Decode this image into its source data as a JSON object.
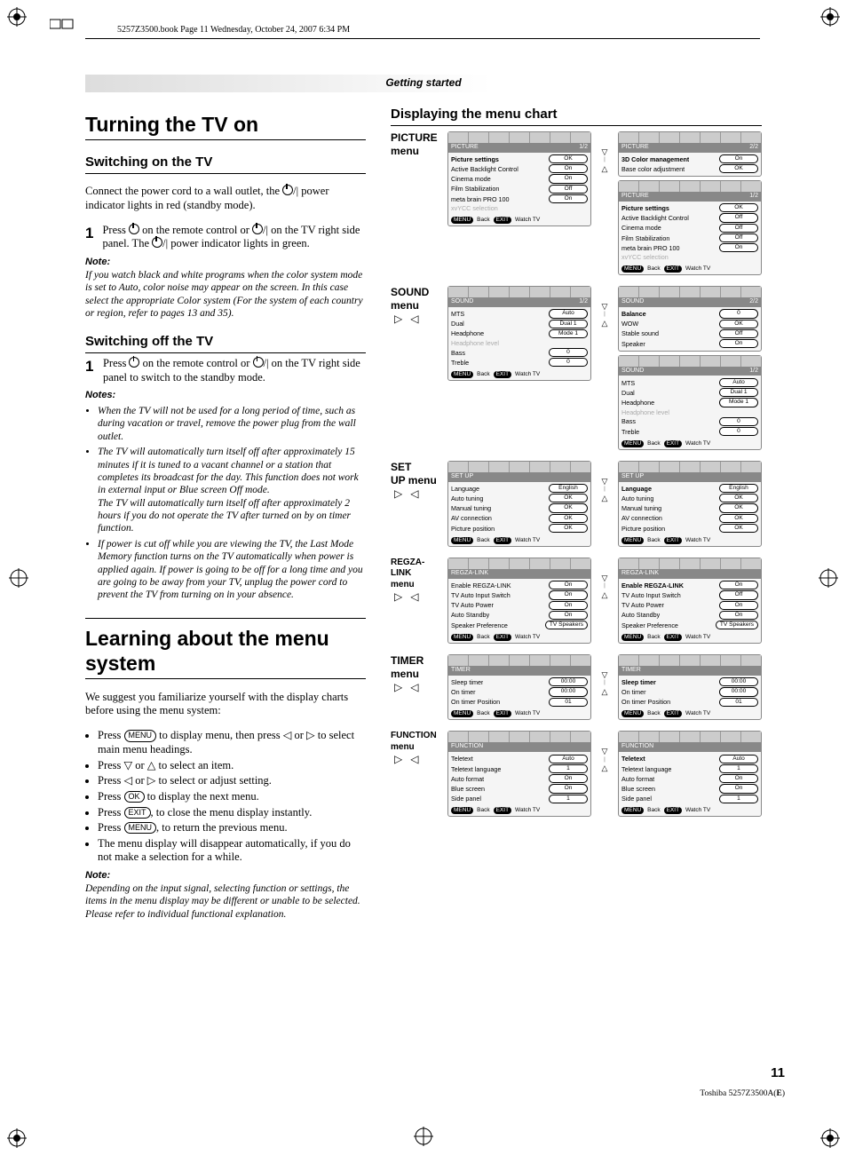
{
  "book_header": "5257Z3500.book  Page 11  Wednesday, October 24, 2007  6:34 PM",
  "section_bar": "Getting started",
  "page_number": "11",
  "footer_code": "Toshiba 5257Z3500A(E)",
  "left": {
    "h1a": "Turning the TV on",
    "switch_on_h": "Switching on the TV",
    "switch_on_p": "Connect the power cord to a wall outlet, the ␣ power indicator lights in red (standby mode).",
    "step1on": "Press ␣ on the remote control or ␣/| on the TV right side panel. The ␣/| power indicator lights in green.",
    "note_hd": "Note:",
    "note_on": "If you watch black and white programs when the color system mode is set to Auto, color noise may appear on the screen. In this case select the appropriate Color system (For the system of each country or region, refer to pages 13 and 35).",
    "switch_off_h": "Switching off the TV",
    "step1off": "Press ␣ on the remote control or ␣/| on the TV right side panel to switch to the standby mode.",
    "notes_hd": "Notes:",
    "note_off_1": "When the TV will not be used for a long period of time, such as during vacation or travel, remove the power plug from the wall outlet.",
    "note_off_2": "The TV will automatically turn itself off after approximately 15 minutes if it is tuned to a vacant channel or a station that completes its broadcast for the day. This function does not work in external input or Blue screen Off mode.\nThe TV will automatically turn itself off after approximately 2 hours if you do not operate the TV after turned on by on timer function.",
    "note_off_3": "If power is cut off while you are viewing the TV, the Last Mode Memory function turns on the TV automatically when power is applied again. If power is going to be off for a long time and you are going to be away from your TV, unplug the power cord to prevent the TV from turning on in your absence.",
    "h1b": "Learning about the menu system",
    "learn_intro": "We suggest you familiarize yourself with the display charts before using the menu system:",
    "learn_b1_a": "Press ",
    "learn_b1_b": " to display menu, then press ◁ or ▷ to select main menu headings.",
    "learn_b2": "Press ▽ or △ to select an item.",
    "learn_b3": "Press ◁ or ▷ to select or adjust setting.",
    "learn_b4_a": "Press ",
    "learn_b4_b": " to display the next menu.",
    "learn_b5_a": "Press ",
    "learn_b5_b": ", to close the menu display instantly.",
    "learn_b6_a": "Press ",
    "learn_b6_b": ", to return the previous menu.",
    "learn_b7": "The menu display will disappear automatically, if you do not make a selection for a while.",
    "learn_note": "Depending on the input signal, selecting function or settings, the items in the menu display may be different or unable to be selected. Please refer to individual functional explanation.",
    "pill_menu": "MENU",
    "pill_ok": "OK",
    "pill_exit": "EXIT"
  },
  "right": {
    "h2": "Displaying the menu chart",
    "foot_menu": "MENU",
    "foot_back": "Back",
    "foot_exit": "EXIT",
    "foot_watch": "Watch TV",
    "labels": {
      "picture": "PICTURE menu",
      "sound": "SOUND menu",
      "setup": "SET UP menu",
      "regza": "REGZA-LINK menu",
      "timer": "TIMER menu",
      "function": "FUNCTION menu"
    },
    "picture_l": {
      "title": "PICTURE",
      "page": "1/2",
      "items": [
        {
          "lab": "Picture settings",
          "val": "OK",
          "sel": true
        },
        {
          "lab": "Active Backlight Control",
          "val": "On"
        },
        {
          "lab": "Cinema mode",
          "val": "On"
        },
        {
          "lab": "Film Stabilization",
          "val": "Off"
        },
        {
          "lab": "meta brain PRO 100",
          "val": "On"
        },
        {
          "lab": "xvYCC selection",
          "val": "",
          "disabled": true
        }
      ]
    },
    "picture_r_top": {
      "title": "PICTURE",
      "page": "2/2",
      "items": [
        {
          "lab": "3D Color management",
          "val": "On",
          "sel": true
        },
        {
          "lab": "Base color adjustment",
          "val": "OK"
        }
      ]
    },
    "picture_r_bot": {
      "title": "PICTURE",
      "page": "1/2",
      "items": [
        {
          "lab": "Picture settings",
          "val": "OK",
          "sel": true
        },
        {
          "lab": "Active Backlight Control",
          "val": "Off"
        },
        {
          "lab": "Cinema mode",
          "val": "Off"
        },
        {
          "lab": "Film Stabilization",
          "val": "Off"
        },
        {
          "lab": "meta brain PRO 100",
          "val": "On"
        },
        {
          "lab": "xvYCC selection",
          "val": "",
          "disabled": true
        }
      ]
    },
    "sound_l": {
      "title": "SOUND",
      "page": "1/2",
      "items": [
        {
          "lab": "MTS",
          "val": "Auto"
        },
        {
          "lab": "Dual",
          "val": "Dual 1"
        },
        {
          "lab": "Headphone",
          "val": "Mode 1"
        },
        {
          "lab": "Headphone level",
          "val": "",
          "disabled": true
        },
        {
          "lab": "Bass",
          "val": "0"
        },
        {
          "lab": "Treble",
          "val": "0"
        }
      ]
    },
    "sound_r_top": {
      "title": "SOUND",
      "page": "2/2",
      "items": [
        {
          "lab": "Balance",
          "val": "0",
          "sel": true
        },
        {
          "lab": "WOW",
          "val": "OK"
        },
        {
          "lab": "Stable sound",
          "val": "Off"
        },
        {
          "lab": "Speaker",
          "val": "On"
        }
      ]
    },
    "sound_r_bot": {
      "title": "SOUND",
      "page": "1/2",
      "items": [
        {
          "lab": "MTS",
          "val": "Auto"
        },
        {
          "lab": "Dual",
          "val": "Dual 1"
        },
        {
          "lab": "Headphone",
          "val": "Mode 1"
        },
        {
          "lab": "Headphone level",
          "val": "",
          "disabled": true
        },
        {
          "lab": "Bass",
          "val": "0"
        },
        {
          "lab": "Treble",
          "val": "0"
        }
      ]
    },
    "setup_l": {
      "title": "SET UP",
      "page": "",
      "items": [
        {
          "lab": "Language",
          "val": "English"
        },
        {
          "lab": "Auto tuning",
          "val": "OK"
        },
        {
          "lab": "Manual tuning",
          "val": "OK"
        },
        {
          "lab": "AV connection",
          "val": "OK"
        },
        {
          "lab": "Picture position",
          "val": "OK"
        }
      ]
    },
    "setup_r": {
      "title": "SET UP",
      "page": "",
      "items": [
        {
          "lab": "Language",
          "val": "English",
          "sel": true
        },
        {
          "lab": "Auto tuning",
          "val": "OK"
        },
        {
          "lab": "Manual tuning",
          "val": "OK"
        },
        {
          "lab": "AV connection",
          "val": "OK"
        },
        {
          "lab": "Picture position",
          "val": "OK"
        }
      ]
    },
    "regza_l": {
      "title": "REGZA-LINK",
      "page": "",
      "items": [
        {
          "lab": "Enable REGZA-LINK",
          "val": "On"
        },
        {
          "lab": "TV Auto Input Switch",
          "val": "On"
        },
        {
          "lab": "TV Auto Power",
          "val": "On"
        },
        {
          "lab": "Auto Standby",
          "val": "On"
        },
        {
          "lab": "Speaker Preference",
          "val": "TV Speakers"
        }
      ]
    },
    "regza_r": {
      "title": "REGZA-LINK",
      "page": "",
      "items": [
        {
          "lab": "Enable REGZA-LINK",
          "val": "On",
          "sel": true
        },
        {
          "lab": "TV Auto Input Switch",
          "val": "Off"
        },
        {
          "lab": "TV Auto Power",
          "val": "On"
        },
        {
          "lab": "Auto Standby",
          "val": "On"
        },
        {
          "lab": "Speaker Preference",
          "val": "TV Speakers"
        }
      ]
    },
    "timer_l": {
      "title": "TIMER",
      "page": "",
      "items": [
        {
          "lab": "Sleep timer",
          "val": "00:00"
        },
        {
          "lab": "On timer",
          "val": "00:00"
        },
        {
          "lab": "On timer Position",
          "val": "01"
        }
      ]
    },
    "timer_r": {
      "title": "TIMER",
      "page": "",
      "items": [
        {
          "lab": "Sleep timer",
          "val": "00:00",
          "sel": true
        },
        {
          "lab": "On timer",
          "val": "00:00"
        },
        {
          "lab": "On timer Position",
          "val": "01"
        }
      ]
    },
    "function_l": {
      "title": "FUNCTION",
      "page": "",
      "items": [
        {
          "lab": "Teletext",
          "val": "Auto"
        },
        {
          "lab": "Teletext language",
          "val": "1"
        },
        {
          "lab": "Auto format",
          "val": "On"
        },
        {
          "lab": "Blue screen",
          "val": "On"
        },
        {
          "lab": "Side panel",
          "val": "1"
        }
      ]
    },
    "function_r": {
      "title": "FUNCTION",
      "page": "",
      "items": [
        {
          "lab": "Teletext",
          "val": "Auto",
          "sel": true
        },
        {
          "lab": "Teletext language",
          "val": "1"
        },
        {
          "lab": "Auto format",
          "val": "On"
        },
        {
          "lab": "Blue screen",
          "val": "On"
        },
        {
          "lab": "Side panel",
          "val": "1"
        }
      ]
    }
  }
}
